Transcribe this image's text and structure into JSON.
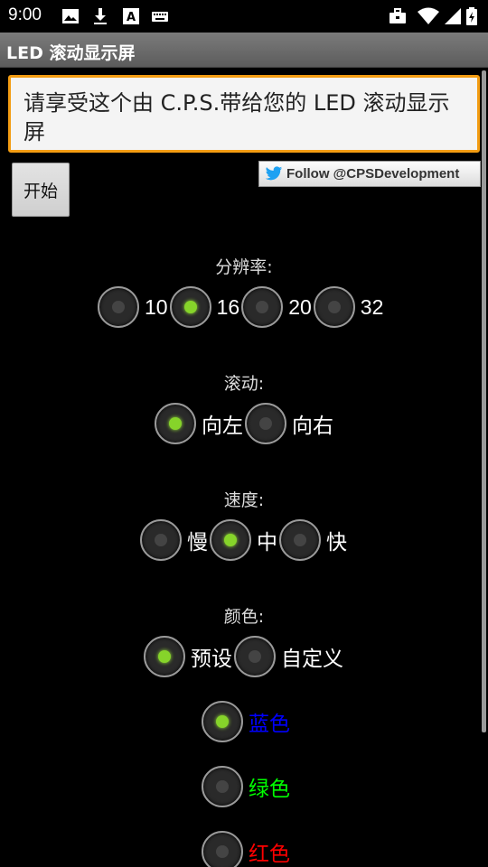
{
  "status_bar": {
    "time": "9:00",
    "icons_left": [
      "image-icon",
      "download-icon",
      "font-icon",
      "keyboard-icon"
    ],
    "icons_right": [
      "briefcase-icon",
      "wifi-icon",
      "signal-icon",
      "battery-icon"
    ]
  },
  "app_bar": {
    "title": "LED 滚动显示屏"
  },
  "message": {
    "value": "请享受这个由 C.P.S.带给您的 LED 滚动显示屏"
  },
  "start_button": {
    "label": "开始"
  },
  "follow": {
    "label": "Follow @CPSDevelopment"
  },
  "resolution": {
    "label": "分辨率:",
    "options": [
      "10",
      "16",
      "20",
      "32"
    ],
    "selected": "16"
  },
  "scroll": {
    "label": "滚动:",
    "options": [
      "向左",
      "向右"
    ],
    "selected": "向左"
  },
  "speed": {
    "label": "速度:",
    "options": [
      "慢",
      "中",
      "快"
    ],
    "selected": "中"
  },
  "color": {
    "label": "颜色:",
    "options": [
      "预设",
      "自定义"
    ],
    "selected": "预设"
  },
  "preset_colors": {
    "options": [
      {
        "label": "蓝色",
        "color": "#0000ff"
      },
      {
        "label": "绿色",
        "color": "#00ff00"
      },
      {
        "label": "红色",
        "color": "#ff0000"
      }
    ],
    "selected": "蓝色"
  },
  "colors": {
    "accent_border": "#f39c12",
    "radio_on": "#86d42a"
  }
}
